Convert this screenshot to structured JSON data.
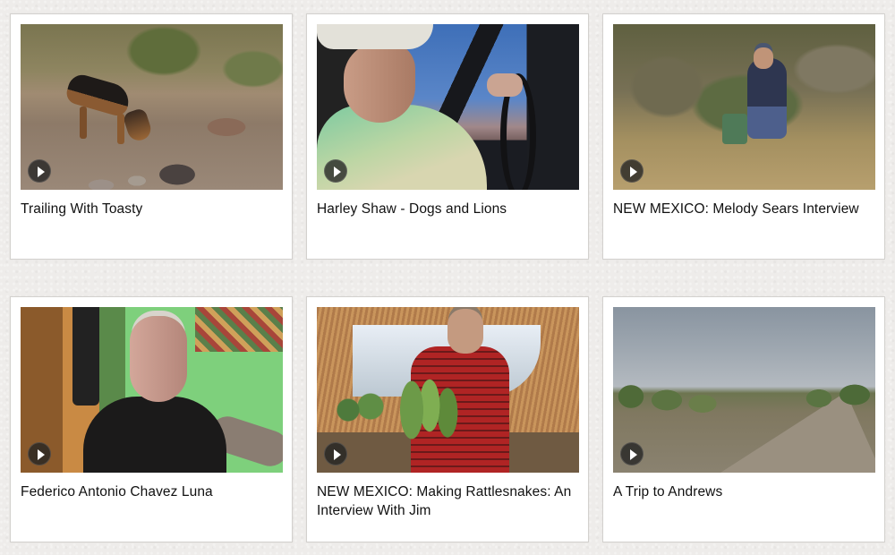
{
  "videos": [
    {
      "title": "Trailing With Toasty",
      "thumbnail": "dog-on-trail"
    },
    {
      "title": "Harley Shaw - Dogs and Lions",
      "thumbnail": "man-driving-truck"
    },
    {
      "title": "NEW MEXICO: Melody Sears Interview",
      "thumbnail": "man-crouching-hillside"
    },
    {
      "title": "Federico Antonio Chavez Luna",
      "thumbnail": "elderly-man-indoors"
    },
    {
      "title": "NEW MEXICO: Making Rattlesnakes: An Interview With Jim",
      "thumbnail": "man-holding-cactus"
    },
    {
      "title": "A Trip to Andrews",
      "thumbnail": "desert-dirt-road"
    }
  ],
  "icons": {
    "play": "play-icon"
  },
  "colors": {
    "background": "#eeecea",
    "card": "#ffffff",
    "title_text": "#111111"
  }
}
